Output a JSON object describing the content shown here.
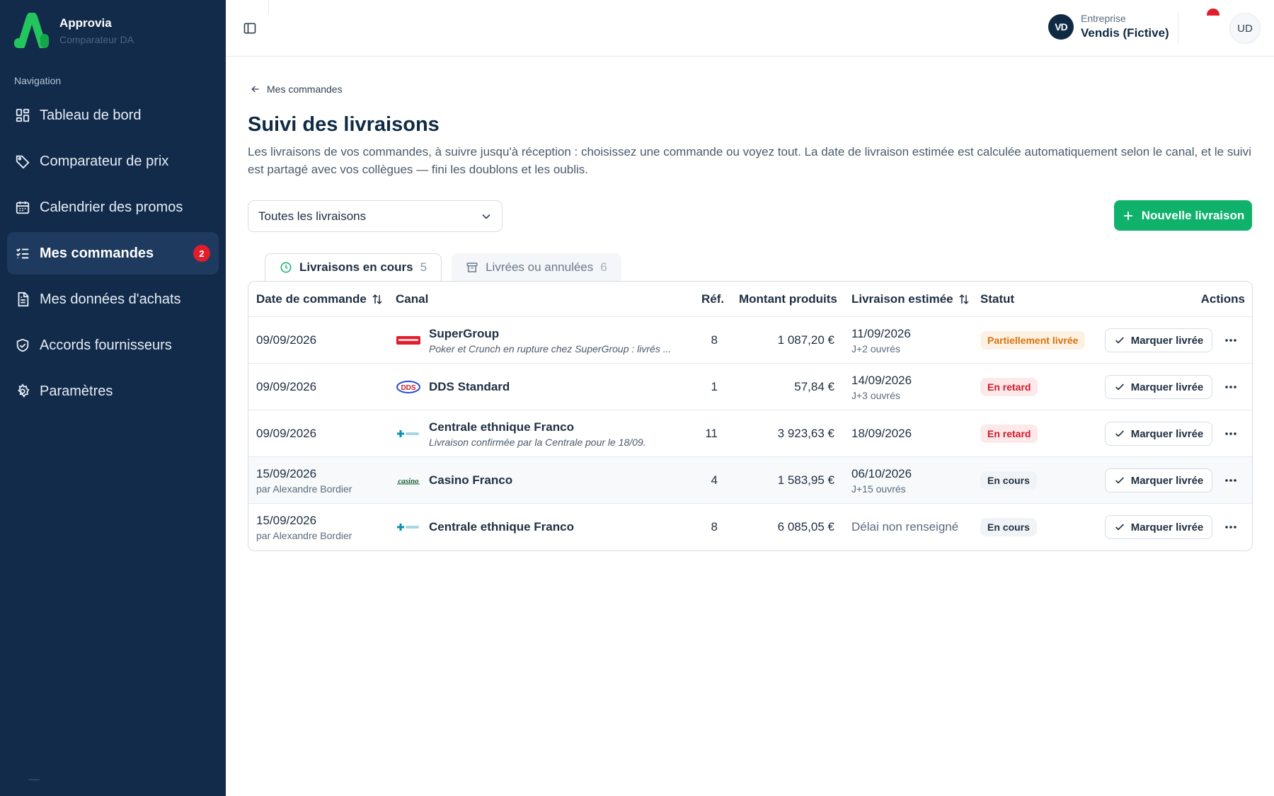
{
  "brand": {
    "name": "Approvia",
    "subtitle": "Comparateur DA"
  },
  "sidebar": {
    "heading": "Navigation",
    "items": [
      {
        "label": "Tableau de bord",
        "icon": "dashboard-icon"
      },
      {
        "label": "Comparateur de prix",
        "icon": "tag-icon"
      },
      {
        "label": "Calendrier des promos",
        "icon": "calendar-icon"
      },
      {
        "label": "Mes commandes",
        "icon": "list-check-icon",
        "active": true,
        "badge": "2"
      },
      {
        "label": "Mes données d'achats",
        "icon": "document-icon"
      },
      {
        "label": "Accords fournisseurs",
        "icon": "handshake-icon"
      },
      {
        "label": "Paramètres",
        "icon": "gear-icon"
      }
    ]
  },
  "topbar": {
    "company_label": "Entreprise",
    "company_name": "Vendis (Fictive)",
    "company_logo": "VD",
    "avatar": "UD"
  },
  "main": {
    "back_label": "Mes commandes",
    "title": "Suivi des livraisons",
    "description": "Les livraisons de vos commandes, à suivre jusqu'à réception : choisissez une commande ou voyez tout. La date de livraison estimée est calculée automatiquement selon le canal, et le suivi est partagé avec vos collègues — fini les doublons et les oublis.",
    "filter_value": "Toutes les livraisons",
    "new_button": "Nouvelle livraison",
    "tabs": [
      {
        "label": "Livraisons en cours",
        "count": "5",
        "icon": "clock-icon"
      },
      {
        "label": "Livrées ou annulées",
        "count": "6",
        "icon": "archive-icon"
      }
    ],
    "columns": {
      "date": "Date de commande",
      "canal": "Canal",
      "ref": "Réf.",
      "montant": "Montant produits",
      "livraison": "Livraison estimée",
      "statut": "Statut",
      "actions": "Actions"
    },
    "mark_label": "Marquer livrée",
    "rows": [
      {
        "date": "09/09/2026",
        "by": "",
        "canal": "SuperGroup",
        "note": "Poker et Crunch en rupture chez SuperGroup : livrés ...",
        "ref": "8",
        "montant": "1 087,20 €",
        "livraison": "11/09/2026",
        "delai": "J+2 ouvrés",
        "statut": "Partiellement livrée",
        "statut_style": "orange",
        "logo": "supergroup"
      },
      {
        "date": "09/09/2026",
        "by": "",
        "canal": "DDS Standard",
        "note": "",
        "ref": "1",
        "montant": "57,84 €",
        "livraison": "14/09/2026",
        "delai": "J+3 ouvrés",
        "statut": "En retard",
        "statut_style": "red",
        "logo": "dds"
      },
      {
        "date": "09/09/2026",
        "by": "",
        "canal": "Centrale ethnique Franco",
        "note": "Livraison confirmée par la Centrale pour le 18/09.",
        "ref": "11",
        "montant": "3 923,63 €",
        "livraison": "18/09/2026",
        "delai": "",
        "statut": "En retard",
        "statut_style": "red",
        "logo": "centrale"
      },
      {
        "date": "15/09/2026",
        "by": "par Alexandre Bordier",
        "canal": "Casino Franco",
        "note": "",
        "ref": "4",
        "montant": "1 583,95 €",
        "livraison": "06/10/2026",
        "delai": "J+15 ouvrés",
        "statut": "En cours",
        "statut_style": "gray",
        "logo": "casino"
      },
      {
        "date": "15/09/2026",
        "by": "par Alexandre Bordier",
        "canal": "Centrale ethnique Franco",
        "note": "",
        "ref": "8",
        "montant": "6 085,05 €",
        "livraison": "Délai non renseigné",
        "delai": "",
        "statut": "En cours",
        "statut_style": "gray",
        "logo": "centrale"
      }
    ]
  },
  "colors": {
    "sidebar": "#122b4a",
    "accent": "#10b26b",
    "danger": "#e11d2b",
    "warning": "#d9730d"
  }
}
